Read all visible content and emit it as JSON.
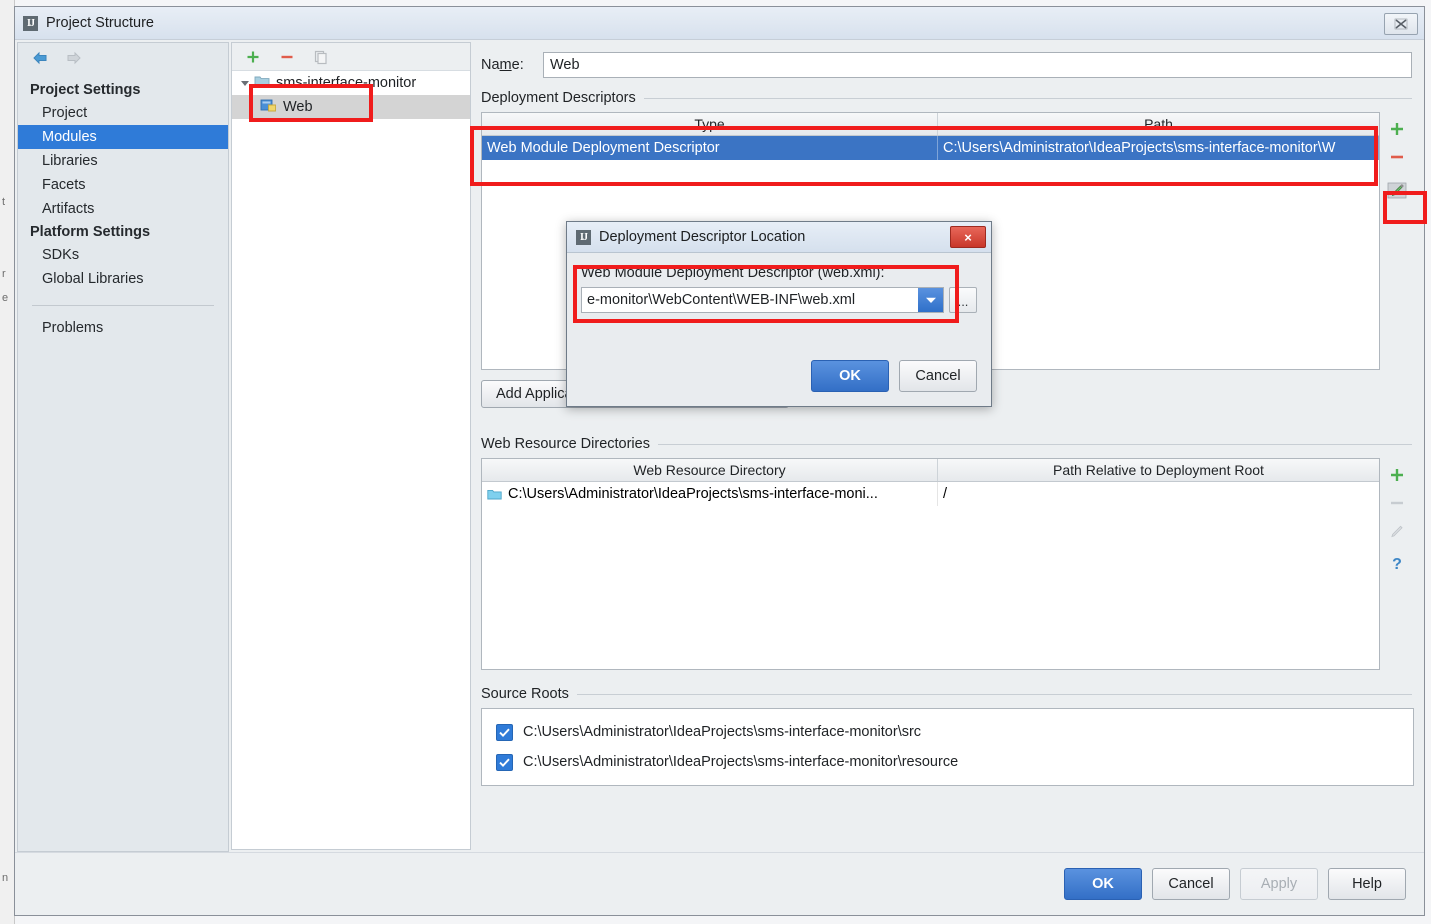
{
  "window": {
    "title": "Project Structure",
    "icon": "intellij-icon",
    "close_label": "close-icon"
  },
  "sidebar": {
    "back_icon": "back-arrow-icon",
    "forward_icon": "forward-arrow-icon",
    "groups": [
      {
        "title": "Project Settings",
        "items": [
          {
            "label": "Project",
            "selected": false
          },
          {
            "label": "Modules",
            "selected": true
          },
          {
            "label": "Libraries",
            "selected": false
          },
          {
            "label": "Facets",
            "selected": false
          },
          {
            "label": "Artifacts",
            "selected": false
          }
        ]
      },
      {
        "title": "Platform Settings",
        "items": [
          {
            "label": "SDKs",
            "selected": false
          },
          {
            "label": "Global Libraries",
            "selected": false
          }
        ]
      }
    ],
    "footer_items": [
      {
        "label": "Problems",
        "selected": false
      }
    ]
  },
  "tree": {
    "toolbar": [
      {
        "name": "add-module-button",
        "icon": "plus-icon"
      },
      {
        "name": "remove-module-button",
        "icon": "minus-icon"
      },
      {
        "name": "copy-module-button",
        "icon": "copy-icon"
      }
    ],
    "nodes": [
      {
        "label": "sms-interface-monitor",
        "icon": "folder-icon",
        "level": 0,
        "expanded": true,
        "selected": false
      },
      {
        "label": "Web",
        "icon": "web-module-icon",
        "level": 1,
        "expanded": false,
        "selected": true
      }
    ]
  },
  "detail": {
    "name_label": "Name:",
    "name_value": "Web",
    "deployment_descriptors": {
      "section_title": "Deployment Descriptors",
      "columns": [
        "Type",
        "Path"
      ],
      "rows": [
        {
          "type": "Web Module Deployment Descriptor",
          "path": "C:\\Users\\Administrator\\IdeaProjects\\sms-interface-monitor\\W",
          "selected": true
        }
      ],
      "tools": [
        {
          "name": "add-descriptor-button",
          "icon": "plus-icon",
          "enabled": true
        },
        {
          "name": "remove-descriptor-button",
          "icon": "minus-icon",
          "enabled": true
        },
        {
          "name": "edit-descriptor-button",
          "icon": "pencil-icon",
          "enabled": true
        }
      ],
      "add_server_descriptor_button": "Add Application Server specific descriptor..."
    },
    "web_resource_directories": {
      "section_title": "Web Resource Directories",
      "columns": [
        "Web Resource Directory",
        "Path Relative to Deployment Root"
      ],
      "rows": [
        {
          "directory": "C:\\Users\\Administrator\\IdeaProjects\\sms-interface-moni...",
          "relative_path": "/",
          "icon": "folder-icon"
        }
      ],
      "tools": [
        {
          "name": "add-web-resource-button",
          "icon": "plus-icon",
          "enabled": true
        },
        {
          "name": "remove-web-resource-button",
          "icon": "minus-icon",
          "enabled": false
        },
        {
          "name": "edit-web-resource-button",
          "icon": "pencil-icon",
          "enabled": false
        },
        {
          "name": "help-web-resource-button",
          "icon": "question-icon",
          "enabled": true
        }
      ]
    },
    "source_roots": {
      "section_title": "Source Roots",
      "rows": [
        {
          "path": "C:\\Users\\Administrator\\IdeaProjects\\sms-interface-monitor\\src",
          "checked": true
        },
        {
          "path": "C:\\Users\\Administrator\\IdeaProjects\\sms-interface-monitor\\resource",
          "checked": true
        }
      ]
    }
  },
  "footer": {
    "buttons": [
      {
        "label": "OK",
        "style": "primary",
        "enabled": true
      },
      {
        "label": "Cancel",
        "style": "normal",
        "enabled": true
      },
      {
        "label": "Apply",
        "style": "disabled",
        "enabled": false
      },
      {
        "label": "Help",
        "style": "normal",
        "enabled": true
      }
    ]
  },
  "dialog": {
    "title": "Deployment Descriptor Location",
    "icon": "intellij-icon",
    "close_label": "×",
    "field_label": "Web Module Deployment Descriptor (web.xml):",
    "field_value": "e-monitor\\WebContent\\WEB-INF\\web.xml",
    "browse_label": "...",
    "ok_label": "OK",
    "cancel_label": "Cancel"
  },
  "annotations": {
    "color": "#f01c1c",
    "boxes": [
      {
        "name": "highlight-web-module-node"
      },
      {
        "name": "highlight-deployment-descriptor-row"
      },
      {
        "name": "highlight-edit-descriptor-button"
      },
      {
        "name": "highlight-descriptor-path-field"
      }
    ]
  },
  "background_ghost": {
    "lines": [
      "t",
      "r",
      "e",
      "n"
    ]
  }
}
